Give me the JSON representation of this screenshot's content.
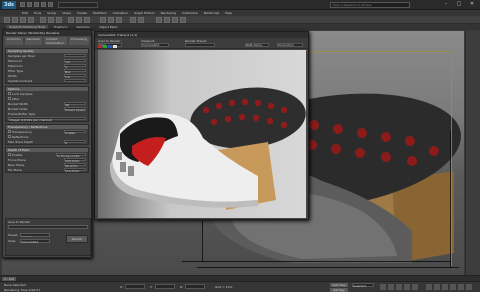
{
  "window": {
    "logo": "3ds",
    "title": "",
    "search_placeholder": "Type a keyword or phrase",
    "min_glyph": "–",
    "max_glyph": "□",
    "close_glyph": "✕"
  },
  "menus": [
    "Edit",
    "Tools",
    "Group",
    "Views",
    "Create",
    "Modifiers",
    "Animation",
    "Graph Editors",
    "Rendering",
    "Customize",
    "MAXScript",
    "Help"
  ],
  "ribbon_tabs": [
    "Graphite Modeling Tools",
    "Freeform",
    "Selection",
    "Object Paint"
  ],
  "viewport": {
    "label": "[+][Camera001][Shaded]"
  },
  "render_setup": {
    "title": "Render Setup: Mental Ray Renderer",
    "tabs": [
      "Common",
      "Renderer",
      "Indirect Illumination",
      "Processing",
      "Render Elements"
    ],
    "rollouts": [
      {
        "header": "Sampling Quality",
        "rows": [
          {
            "label": "Samples per Pixel",
            "value": ""
          },
          {
            "label": "Minimum",
            "value": "1/4"
          },
          {
            "label": "Maximum",
            "value": "4"
          },
          {
            "label": "Filter Type",
            "value": "Box"
          },
          {
            "label": "Width",
            "value": "1.0"
          },
          {
            "label": "Spatial Contrast",
            "value": ""
          }
        ]
      },
      {
        "header": "Options",
        "rows": [
          {
            "label": "Lock Samples",
            "value": ""
          },
          {
            "label": "Jitter",
            "value": ""
          },
          {
            "label": "Bucket Width",
            "value": "48"
          },
          {
            "label": "Bucket Order",
            "value": "Hilbert (best)"
          },
          {
            "label": "Frame Buffer Type",
            "value": "Integer (16 bits per channel)"
          }
        ]
      },
      {
        "header": "Transparency / Reflections",
        "rows": [
          {
            "label": "Transparency",
            "value": "Enable"
          },
          {
            "label": "Reflections",
            "value": ""
          },
          {
            "label": "Max Trace Depth",
            "value": "6"
          }
        ]
      },
      {
        "header": "Depth of Field",
        "rows": [
          {
            "label": "Enable",
            "value": "In Focus Limits"
          },
          {
            "label": "Focus Plane",
            "value": "100.0mm"
          },
          {
            "label": "Near Plane",
            "value": "90.0mm"
          },
          {
            "label": "Far Plane",
            "value": "110.0mm"
          }
        ]
      }
    ],
    "bottom_label": "Area to Render",
    "preset_label": "Preset:",
    "preset_value": "----------",
    "view_label": "View:",
    "view_value": "Camera001",
    "render_button": "Render"
  },
  "framebuffer": {
    "title": "Camera001, frame 0 (1:1)",
    "area_label": "Area to Render:",
    "area_value": "View",
    "viewport_label": "Viewport:",
    "viewport_value": "Camera001",
    "preset_label": "Render Preset:",
    "preset_value": "",
    "channel_value": "RGB Alpha",
    "production_value": "Production"
  },
  "status": {
    "selected": "None Selected",
    "hint": "Rendering Time 0:00:57",
    "x_label": "X:",
    "y_label": "Y:",
    "z_label": "Z:",
    "grid": "Grid = 10.0",
    "autokey": "Auto Key",
    "setkey": "Set Key",
    "selected_label": "Selected",
    "frame": "0 / 100"
  }
}
